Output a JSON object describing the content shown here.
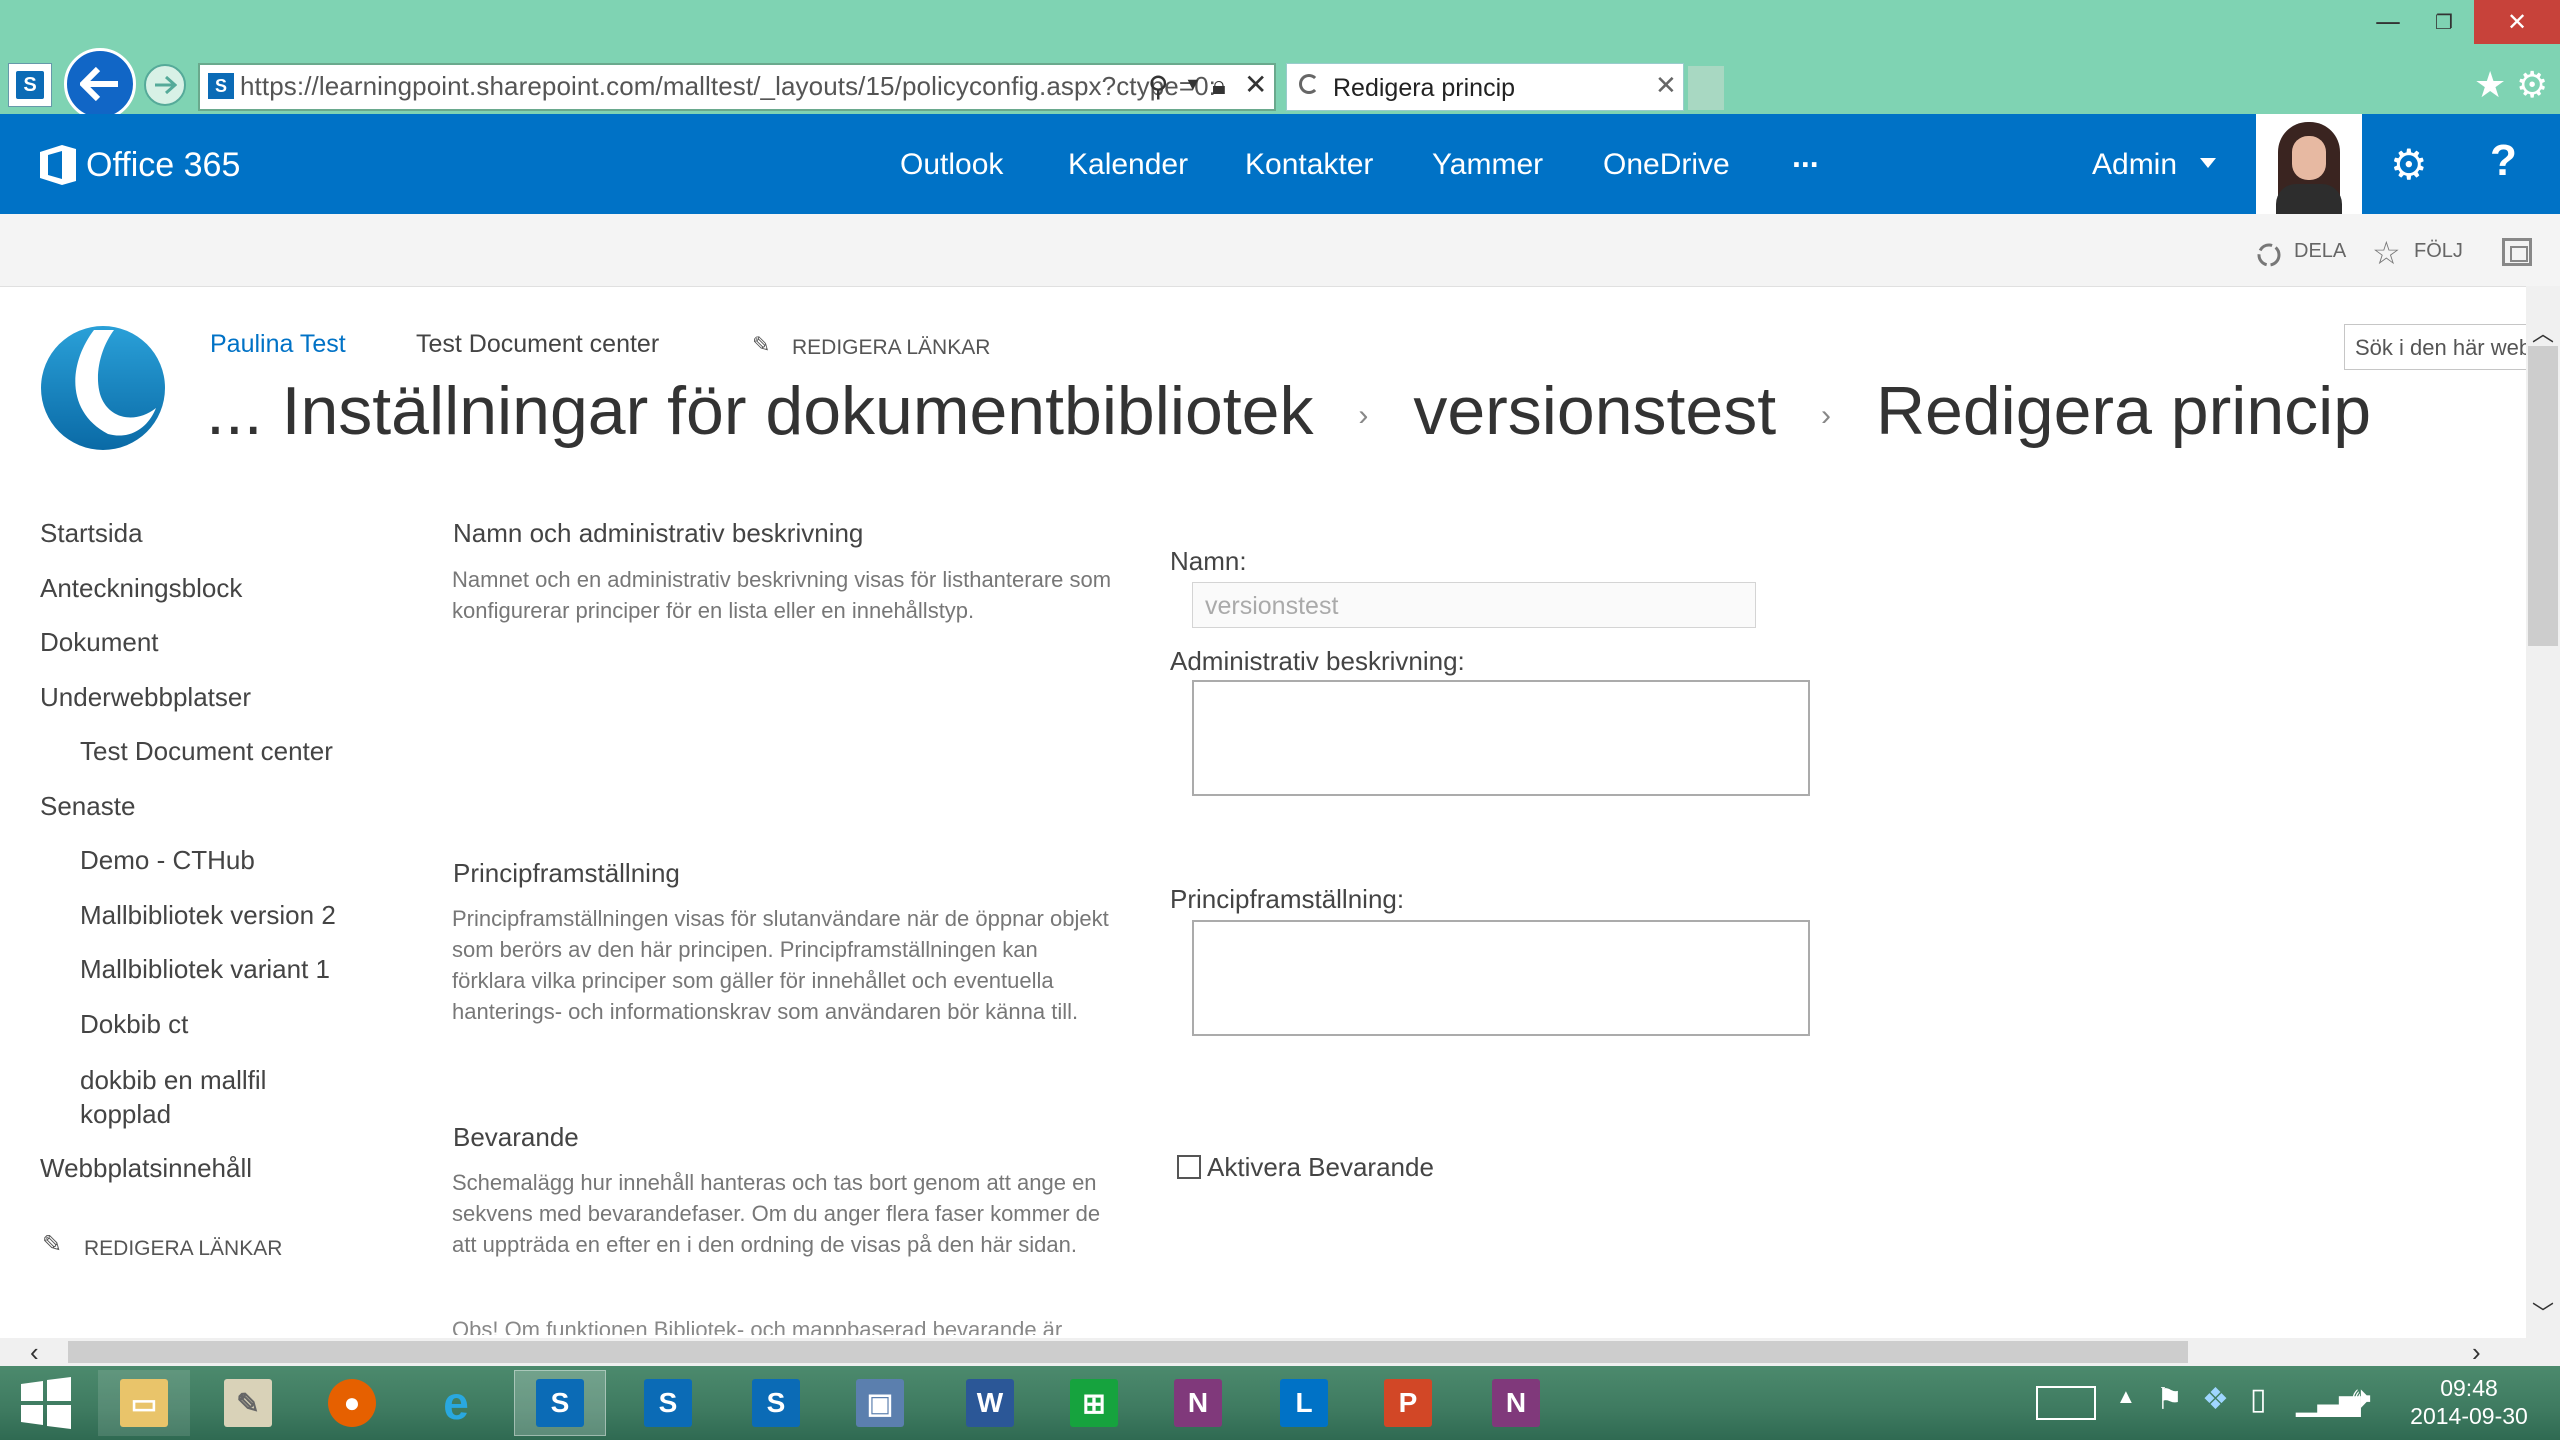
{
  "browser": {
    "url": "https://learningpoint.sharepoint.com/malltest/_layouts/15/policyconfig.aspx?ctype=0:",
    "tab_title": "Redigera princip"
  },
  "suitebar": {
    "brand": "Office 365",
    "links": [
      "Outlook",
      "Kalender",
      "Kontakter",
      "Yammer",
      "OneDrive",
      "..."
    ],
    "user": "Admin"
  },
  "ribbon": {
    "share": "DELA",
    "follow": "FÖLJ"
  },
  "site": {
    "top_links": [
      "Paulina Test",
      "Test Document center"
    ],
    "edit_links": "REDIGERA LÄNKAR",
    "search_placeholder": "Sök i den här webbplatsen",
    "breadcrumb": [
      "... Inställningar för dokumentbibliotek",
      "versionstest",
      "Redigera princip"
    ],
    "breadcrumb_sep": "›"
  },
  "leftnav": {
    "items": [
      "Startsida",
      "Anteckningsblock",
      "Dokument",
      "Underwebbplatser",
      "Test Document center",
      "Senaste",
      "Demo - CTHub",
      "Mallbibliotek version 2",
      "Mallbibliotek variant 1",
      "Dokbib ct",
      "dokbib en mallfil kopplad",
      "Webbplatsinnehåll"
    ],
    "edit_links": "REDIGERA LÄNKAR"
  },
  "form": {
    "name_section": {
      "title": "Namn och administrativ beskrivning",
      "description": "Namnet och en administrativ beskrivning visas för listhanterare som konfigurerar principer för en lista eller en innehållstyp.",
      "name_label": "Namn:",
      "name_value": "versionstest",
      "admin_desc_label": "Administrativ beskrivning:"
    },
    "statement_section": {
      "title": "Principframställning",
      "description": "Principframställningen visas för slutanvändare när de öppnar objekt som berörs av den här principen. Principframställningen kan förklara vilka principer som gäller för innehållet och eventuella hanterings- och informationskrav som användaren bör känna till.",
      "label": "Principframställning:"
    },
    "retention_section": {
      "title": "Bevarande",
      "description": "Schemalägg hur innehåll hanteras och tas bort genom att ange en sekvens med bevarandefaser. Om du anger flera faser kommer de att uppträda en efter en i den ordning de visas på den här sidan.",
      "checkbox_label": "Aktivera Bevarande",
      "checkbox_checked": false,
      "cut_text": "Obs! Om funktionen Bibliotek- och mappbaserad bevarande är"
    }
  },
  "taskbar": {
    "time": "09:48",
    "date": "2014-09-30"
  }
}
